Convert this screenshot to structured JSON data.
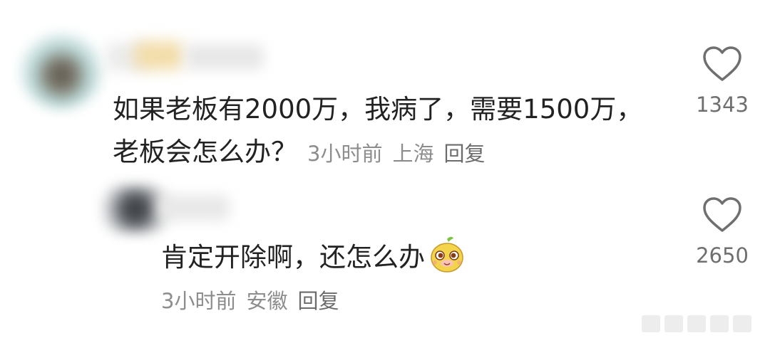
{
  "comments": [
    {
      "text_line1": "如果老板有2000万，我病了，需要1500万，",
      "text_line2": "老板会怎么办？",
      "time": "3小时前",
      "location": "上海",
      "reply_label": "回复",
      "likes": "1343"
    },
    {
      "text": "肯定开除啊，还怎么办",
      "emoji": "cute-face-emoji",
      "time": "3小时前",
      "location": "安徽",
      "reply_label": "回复",
      "likes": "2650"
    }
  ],
  "icons": {
    "like": "heart-outline-icon"
  },
  "colors": {
    "text": "#222222",
    "meta": "#8d8d8d",
    "icon": "#6f6f6f"
  }
}
